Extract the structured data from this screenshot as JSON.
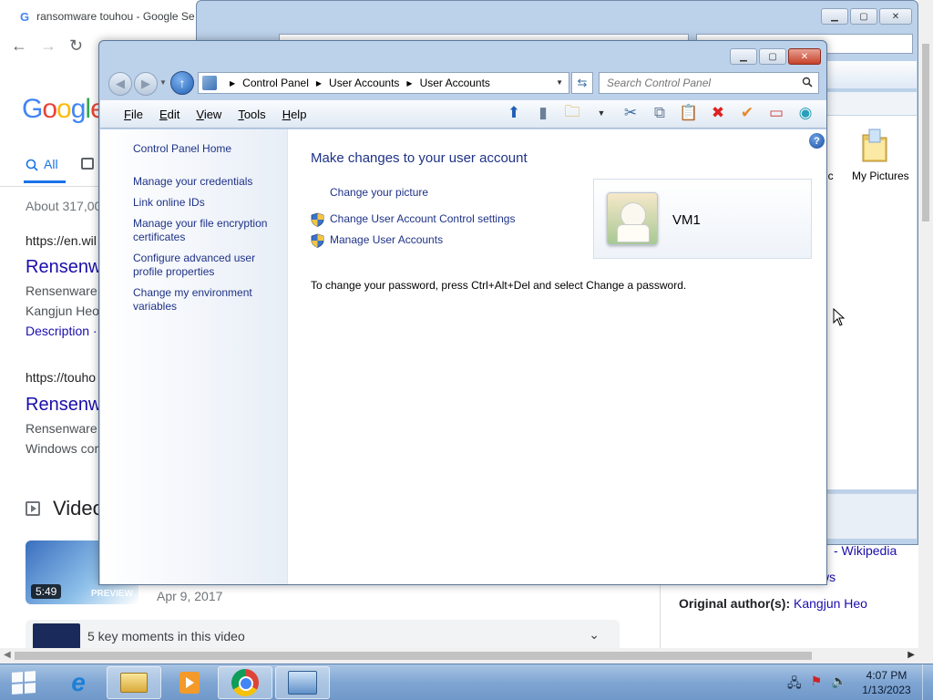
{
  "chrome": {
    "tab_title": "ransomware touhou - Google Se",
    "favicon": "G",
    "back_icon": "←",
    "forward_icon": "→",
    "reload_icon": "↻",
    "logo_letters": [
      "G",
      "o",
      "o",
      "g",
      "l",
      "e"
    ],
    "tab_all": "All",
    "result_stats": "About 317,00",
    "results": [
      {
        "url": "https://en.wil",
        "title": "Rensenw",
        "snippet1": "Rensenware",
        "snippet2": "Kangjun Heo",
        "desc": "Description ·"
      },
      {
        "url": "https://touho",
        "title": "Rensenw",
        "snippet1": "Rensenware",
        "snippet2": "Windows cor"
      }
    ],
    "videos_heading": "Video",
    "video": {
      "duration": "5:49",
      "badge": "PREVIEW",
      "date": "Apr 9, 2017"
    },
    "key_moments": "5 key moments in this video",
    "panel": {
      "wiki": "- Wikipedia",
      "ws": "ws",
      "orig_label": "Original author(s):",
      "orig_value": "Kangjun Heo"
    }
  },
  "explorer": {
    "folder_label": "My Pictures",
    "folder_cut_label": "ic"
  },
  "control_panel": {
    "breadcrumb": [
      "Control Panel",
      "User Accounts",
      "User Accounts"
    ],
    "search_placeholder": "Search Control Panel",
    "menu": [
      {
        "accel": "F",
        "rest": "ile"
      },
      {
        "accel": "E",
        "rest": "dit"
      },
      {
        "accel": "V",
        "rest": "iew"
      },
      {
        "accel": "T",
        "rest": "ools"
      },
      {
        "accel": "H",
        "rest": "elp"
      }
    ],
    "sidebar": {
      "home": "Control Panel Home",
      "items": [
        "Manage your credentials",
        "Link online IDs",
        "Manage your file encryption certificates",
        "Configure advanced user profile properties",
        "Change my environment variables"
      ]
    },
    "heading": "Make changes to your user account",
    "links": {
      "change_picture": "Change your picture",
      "uac_settings": "Change User Account Control settings",
      "manage_accounts": "Manage User Accounts"
    },
    "account_name": "VM1",
    "password_note": "To change your password, press Ctrl+Alt+Del and select Change a password.",
    "help_glyph": "?"
  },
  "taskbar": {
    "time": "4:07 PM",
    "date": "1/13/2023"
  },
  "colors": {
    "link_blue": "#1e3287",
    "google_link": "#1a0dab",
    "window_frame": "#bcd1ea",
    "taskbar": "#7fa6d3"
  }
}
